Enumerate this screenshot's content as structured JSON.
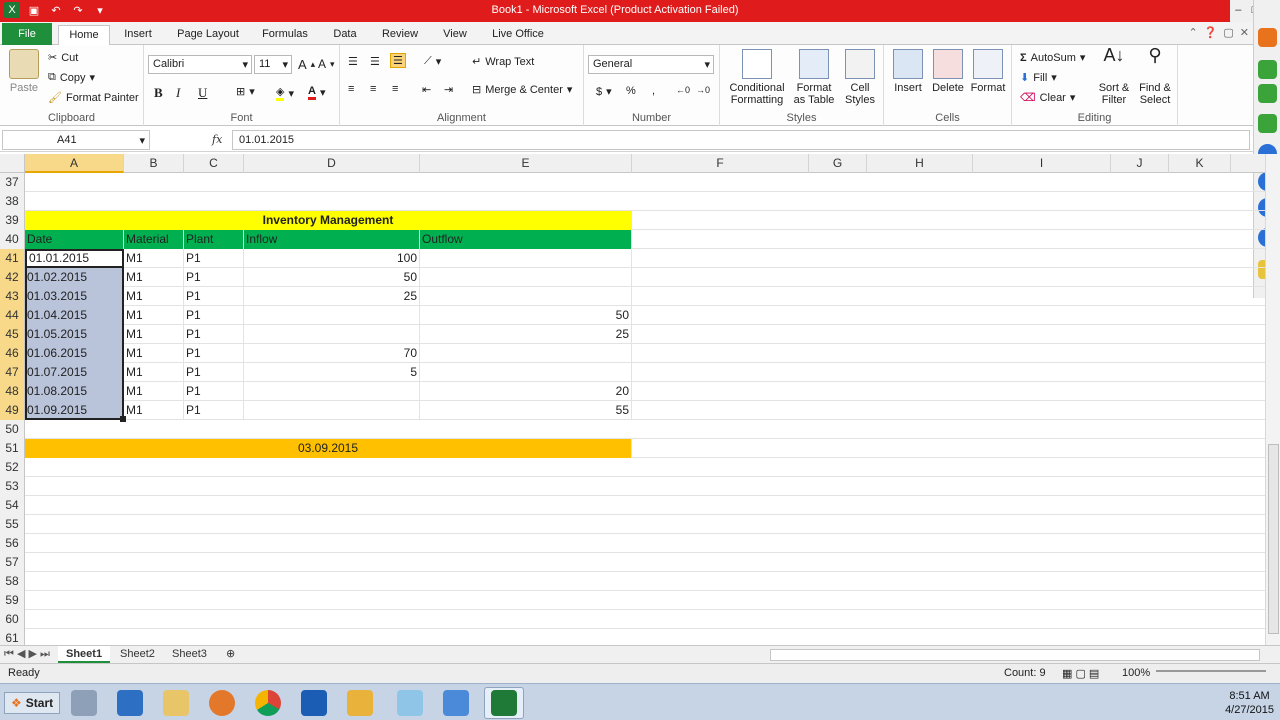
{
  "window": {
    "title": "Book1 - Microsoft Excel (Product Activation Failed)",
    "controls": [
      "–",
      "□",
      "✕"
    ]
  },
  "tabs": [
    {
      "label": "File",
      "key": "file"
    },
    {
      "label": "Home",
      "key": "home"
    },
    {
      "label": "Insert",
      "key": "insert"
    },
    {
      "label": "Page Layout",
      "key": "pagelayout"
    },
    {
      "label": "Formulas",
      "key": "formulas"
    },
    {
      "label": "Data",
      "key": "data"
    },
    {
      "label": "Review",
      "key": "review"
    },
    {
      "label": "View",
      "key": "view"
    },
    {
      "label": "Live Office",
      "key": "liveoffice"
    }
  ],
  "ribbon": {
    "clipboard": {
      "label": "Clipboard",
      "paste": "Paste",
      "cut": "Cut",
      "copy": "Copy",
      "format_painter": "Format Painter"
    },
    "font": {
      "label": "Font",
      "name": "Calibri",
      "size": "11",
      "bold": "B",
      "italic": "I",
      "underline": "U"
    },
    "alignment": {
      "label": "Alignment",
      "wrap_text": "Wrap Text",
      "merge_center": "Merge & Center"
    },
    "number": {
      "label": "Number",
      "format": "General",
      "currency": "$",
      "percent": "%",
      "comma": ","
    },
    "styles": {
      "label": "Styles",
      "conditional": "Conditional",
      "conditional2": "Formatting",
      "format_table": "Format",
      "format_table2": "as Table",
      "cell_styles": "Cell",
      "cell_styles2": "Styles"
    },
    "cells": {
      "label": "Cells",
      "insert": "Insert",
      "delete": "Delete",
      "format": "Format"
    },
    "editing": {
      "label": "Editing",
      "autosum": "AutoSum",
      "fill": "Fill",
      "clear": "Clear",
      "sort": "Sort &",
      "sort2": "Filter",
      "find": "Find &",
      "find2": "Select"
    }
  },
  "formula_bar": {
    "name_box": "A41",
    "fx": "fx",
    "value": "01.01.2015"
  },
  "columns": [
    "A",
    "B",
    "C",
    "D",
    "E",
    "F",
    "G",
    "H",
    "I",
    "J",
    "K"
  ],
  "rows": [
    {
      "n": "37",
      "cells": []
    },
    {
      "n": "38",
      "cells": []
    },
    {
      "n": "39",
      "cells": [],
      "title": "Inventory Management"
    },
    {
      "n": "40",
      "cells": [
        "Date",
        "Material",
        "Plant",
        "Inflow",
        "Outflow"
      ],
      "header": true
    },
    {
      "n": "41",
      "cells": [
        "01.01.2015",
        "M1",
        "P1",
        "100",
        ""
      ]
    },
    {
      "n": "42",
      "cells": [
        "01.02.2015",
        "M1",
        "P1",
        "50",
        ""
      ]
    },
    {
      "n": "43",
      "cells": [
        "01.03.2015",
        "M1",
        "P1",
        "25",
        ""
      ]
    },
    {
      "n": "44",
      "cells": [
        "01.04.2015",
        "M1",
        "P1",
        "",
        "50"
      ]
    },
    {
      "n": "45",
      "cells": [
        "01.05.2015",
        "M1",
        "P1",
        "",
        "25"
      ]
    },
    {
      "n": "46",
      "cells": [
        "01.06.2015",
        "M1",
        "P1",
        "70",
        ""
      ]
    },
    {
      "n": "47",
      "cells": [
        "01.07.2015",
        "M1",
        "P1",
        "5",
        ""
      ]
    },
    {
      "n": "48",
      "cells": [
        "01.08.2015",
        "M1",
        "P1",
        "",
        "20"
      ]
    },
    {
      "n": "49",
      "cells": [
        "01.09.2015",
        "M1",
        "P1",
        "",
        "55"
      ]
    },
    {
      "n": "50",
      "cells": []
    },
    {
      "n": "51",
      "cells": [],
      "band": "03.09.2015"
    },
    {
      "n": "52",
      "cells": []
    },
    {
      "n": "53",
      "cells": []
    },
    {
      "n": "54",
      "cells": []
    },
    {
      "n": "55",
      "cells": []
    },
    {
      "n": "56",
      "cells": []
    },
    {
      "n": "57",
      "cells": []
    },
    {
      "n": "58",
      "cells": []
    },
    {
      "n": "59",
      "cells": []
    },
    {
      "n": "60",
      "cells": []
    },
    {
      "n": "61",
      "cells": []
    }
  ],
  "sheets": [
    "Sheet1",
    "Sheet2",
    "Sheet3"
  ],
  "status": {
    "ready": "Ready",
    "count": "Count: 9",
    "zoom": "100%"
  },
  "taskbar": {
    "start": "Start",
    "time": "8:51 AM",
    "date": "4/27/2015"
  },
  "colors": {
    "title_red": "#e01b1b",
    "file_green": "#1f8f3c",
    "header_green": "#00b050",
    "title_yellow": "#ffff00",
    "band_orange": "#ffc000",
    "selection": "#b9c3d9"
  }
}
